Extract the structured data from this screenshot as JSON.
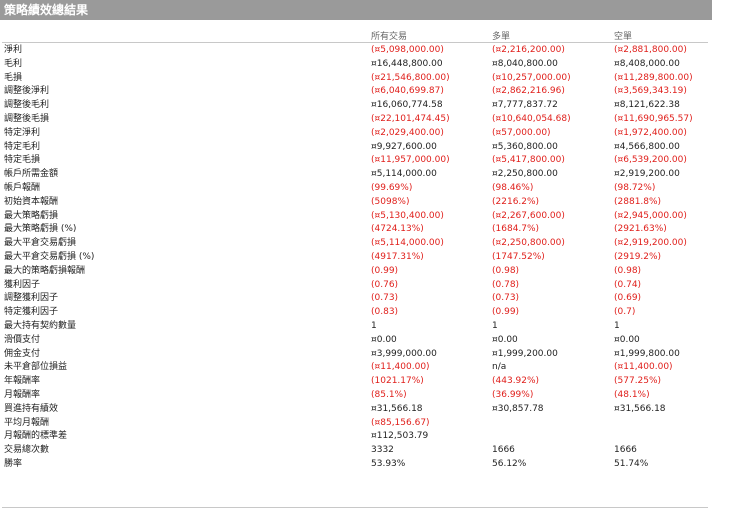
{
  "title": "策略績效總結果",
  "columns": [
    "所有交易",
    "多單",
    "空單"
  ],
  "rows": [
    {
      "label": "淨利",
      "values": [
        "(¤5,098,000.00)",
        "(¤2,216,200.00)",
        "(¤2,881,800.00)"
      ]
    },
    {
      "label": "毛利",
      "values": [
        "¤16,448,800.00",
        "¤8,040,800.00",
        "¤8,408,000.00"
      ]
    },
    {
      "label": "毛損",
      "values": [
        "(¤21,546,800.00)",
        "(¤10,257,000.00)",
        "(¤11,289,800.00)"
      ]
    },
    {
      "label": "調整後淨利",
      "values": [
        "(¤6,040,699.87)",
        "(¤2,862,216.96)",
        "(¤3,569,343.19)"
      ]
    },
    {
      "label": "調整後毛利",
      "values": [
        "¤16,060,774.58",
        "¤7,777,837.72",
        "¤8,121,622.38"
      ]
    },
    {
      "label": "調整後毛損",
      "values": [
        "(¤22,101,474.45)",
        "(¤10,640,054.68)",
        "(¤11,690,965.57)"
      ]
    },
    {
      "label": "特定淨利",
      "values": [
        "(¤2,029,400.00)",
        "(¤57,000.00)",
        "(¤1,972,400.00)"
      ]
    },
    {
      "label": "特定毛利",
      "values": [
        "¤9,927,600.00",
        "¤5,360,800.00",
        "¤4,566,800.00"
      ]
    },
    {
      "label": "特定毛損",
      "values": [
        "(¤11,957,000.00)",
        "(¤5,417,800.00)",
        "(¤6,539,200.00)"
      ]
    },
    {
      "label": "帳戶所需金額",
      "values": [
        "¤5,114,000.00",
        "¤2,250,800.00",
        "¤2,919,200.00"
      ]
    },
    {
      "label": "帳戶報酬",
      "values": [
        "(99.69%)",
        "(98.46%)",
        "(98.72%)"
      ]
    },
    {
      "label": "初始資本報酬",
      "values": [
        "(5098%)",
        "(2216.2%)",
        "(2881.8%)"
      ]
    },
    {
      "label": "最大策略虧損",
      "values": [
        "(¤5,130,400.00)",
        "(¤2,267,600.00)",
        "(¤2,945,000.00)"
      ]
    },
    {
      "label": "最大策略虧損 (%)",
      "values": [
        "(4724.13%)",
        "(1684.7%)",
        "(2921.63%)"
      ]
    },
    {
      "label": "最大平倉交易虧損",
      "values": [
        "(¤5,114,000.00)",
        "(¤2,250,800.00)",
        "(¤2,919,200.00)"
      ]
    },
    {
      "label": "最大平倉交易虧損 (%)",
      "values": [
        "(4917.31%)",
        "(1747.52%)",
        "(2919.2%)"
      ]
    },
    {
      "label": "最大的策略虧損報酬",
      "values": [
        "(0.99)",
        "(0.98)",
        "(0.98)"
      ]
    },
    {
      "label": "獲利因子",
      "values": [
        "(0.76)",
        "(0.78)",
        "(0.74)"
      ]
    },
    {
      "label": "調整獲利因子",
      "values": [
        "(0.73)",
        "(0.73)",
        "(0.69)"
      ]
    },
    {
      "label": "特定獲利因子",
      "values": [
        "(0.83)",
        "(0.99)",
        "(0.7)"
      ]
    },
    {
      "label": "最大持有契約數量",
      "values": [
        "1",
        "1",
        "1"
      ]
    },
    {
      "label": "滑價支付",
      "values": [
        "¤0.00",
        "¤0.00",
        "¤0.00"
      ]
    },
    {
      "label": "佣金支付",
      "values": [
        "¤3,999,000.00",
        "¤1,999,200.00",
        "¤1,999,800.00"
      ]
    },
    {
      "label": "未平倉部位損益",
      "values": [
        "(¤11,400.00)",
        "n/a",
        "(¤11,400.00)"
      ]
    },
    {
      "label": "年報酬率",
      "values": [
        "(1021.17%)",
        "(443.92%)",
        "(577.25%)"
      ]
    },
    {
      "label": "月報酬率",
      "values": [
        "(85.1%)",
        "(36.99%)",
        "(48.1%)"
      ]
    },
    {
      "label": "買進持有績效",
      "values": [
        "¤31,566.18",
        "¤30,857.78",
        "¤31,566.18"
      ]
    },
    {
      "label": "平均月報酬",
      "values": [
        "(¤85,156.67)",
        "",
        ""
      ]
    },
    {
      "label": "月報酬的標準差",
      "values": [
        "¤112,503.79",
        "",
        ""
      ]
    },
    {
      "label": "交易總次數",
      "values": [
        "3332",
        "1666",
        "1666"
      ]
    },
    {
      "label": "勝率",
      "values": [
        "53.93%",
        "56.12%",
        "51.74%"
      ]
    }
  ],
  "colors": {
    "negative": "#e0201c",
    "titlebar": "#9a9a9a",
    "text": "#222222"
  }
}
